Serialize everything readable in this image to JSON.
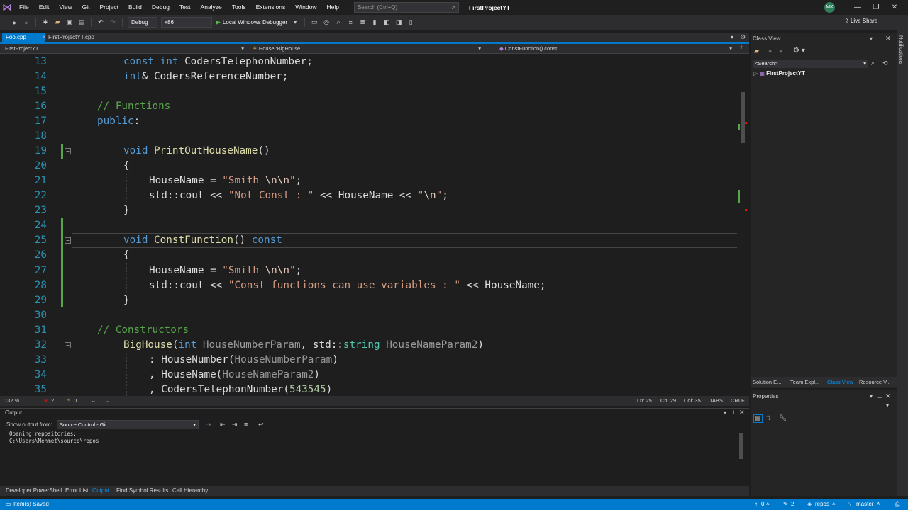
{
  "menu": {
    "items": [
      "File",
      "Edit",
      "View",
      "Git",
      "Project",
      "Build",
      "Debug",
      "Test",
      "Analyze",
      "Tools",
      "Extensions",
      "Window",
      "Help"
    ],
    "search_placeholder": "Search (Ctrl+Q)",
    "solution_title": "FirstProjectYT",
    "avatar_initials": "MK"
  },
  "toolbar": {
    "config": "Debug",
    "platform": "x86",
    "run_label": "Local Windows Debugger",
    "live_share": "Live Share"
  },
  "tabs": [
    {
      "label": "Foo.cpp",
      "active": true
    },
    {
      "label": "FirstProjectYT.cpp",
      "active": false
    }
  ],
  "navbar": {
    "project": "FirstProjectYT",
    "scope": "House::BigHouse",
    "member": "ConstFunction() const"
  },
  "editor": {
    "current_line": 25,
    "lines": [
      {
        "n": "13",
        "tokens": [
          [
            "    const int ",
            "kw-mix"
          ]
        ]
      },
      {
        "n": "14"
      },
      {
        "n": "15"
      },
      {
        "n": "16"
      },
      {
        "n": "17"
      },
      {
        "n": "18"
      },
      {
        "n": "19"
      },
      {
        "n": "20"
      },
      {
        "n": "21"
      },
      {
        "n": "22"
      },
      {
        "n": "23"
      },
      {
        "n": "24"
      },
      {
        "n": "25"
      },
      {
        "n": "26"
      },
      {
        "n": "27"
      },
      {
        "n": "28"
      },
      {
        "n": "29"
      },
      {
        "n": "30"
      },
      {
        "n": "31"
      },
      {
        "n": "32"
      },
      {
        "n": "33"
      },
      {
        "n": "34"
      },
      {
        "n": "35"
      }
    ],
    "text": {
      "l13a": "const int ",
      "l13b": "CodersTelephonNumber;",
      "l14a": "int",
      "l14b": "& CodersReferenceNumber;",
      "l16": "// Functions",
      "l17a": "public",
      "l17b": ":",
      "l19a": "void ",
      "l19b": "PrintOutHouseName",
      "l19c": "()",
      "l20": "{",
      "l21a": "HouseName = ",
      "l21b": "\"Smith ",
      "l21c": "\\n\\n",
      "l21d": "\"",
      "l21e": ";",
      "l22a": "std::cout << ",
      "l22b": "\"Not Const : \"",
      "l22c": " << HouseName << ",
      "l22d": "\"",
      "l22e": "\\n",
      "l22f": "\"",
      "l22g": ";",
      "l23": "}",
      "l25a": "void ",
      "l25b": "ConstFunction",
      "l25c": "() ",
      "l25d": "const",
      "l26": "{",
      "l27a": "HouseName = ",
      "l27b": "\"Smith ",
      "l27c": "\\n\\n",
      "l27d": "\"",
      "l27e": ";",
      "l28a": "std::cout << ",
      "l28b": "\"Const functions can use variables : \"",
      "l28c": " << HouseName;",
      "l29": "}",
      "l31": "// Constructors",
      "l32a": "BigHouse",
      "l32b": "(",
      "l32c": "int ",
      "l32d": "HouseNumberParam",
      "l32e": ", std::",
      "l32f": "string ",
      "l32g": "HouseNameParam2",
      "l32h": ")",
      "l33a": ": HouseNumber(",
      "l33b": "HouseNumberParam",
      "l33c": ")",
      "l34a": ", HouseName(",
      "l34b": "HouseNameParam2",
      "l34c": ")",
      "l35a": ", CodersTelephonNumber(",
      "l35b": "543545",
      "l35c": ")"
    }
  },
  "editor_status": {
    "zoom": "132 %",
    "errors": "2",
    "warnings": "0",
    "ln": "Ln: 25",
    "ch": "Ch: 29",
    "col": "Col: 35",
    "tabs": "TABS",
    "eol": "CRLF"
  },
  "output": {
    "title": "Output",
    "show_from_label": "Show output from:",
    "source": "Source Control - Git",
    "line1": "Opening repositories:",
    "line2": "C:\\Users\\Mehmet\\source\\repos"
  },
  "bottom_tabs": [
    "Developer PowerShell",
    "Error List",
    "Output",
    "Find Symbol Results",
    "Call Hierarchy"
  ],
  "bottom_active": "Output",
  "class_view": {
    "title": "Class View",
    "search": "<Search>",
    "root": "FirstProjectYT"
  },
  "right_tabs": [
    "Solution E...",
    "Team Expl...",
    "Class View",
    "Resource V..."
  ],
  "properties_title": "Properties",
  "notifications_label": "Notifications",
  "statusbar": {
    "saved": "Item(s) Saved",
    "up": "0",
    "pencil": "2",
    "repo": "repos",
    "branch": "master"
  },
  "colors": {
    "accent": "#007acc",
    "keyword": "#569cd6",
    "function": "#dcdcaa",
    "string": "#d69d85",
    "comment": "#57a64a",
    "type": "#4ec9b0",
    "line_number": "#2b91af"
  }
}
